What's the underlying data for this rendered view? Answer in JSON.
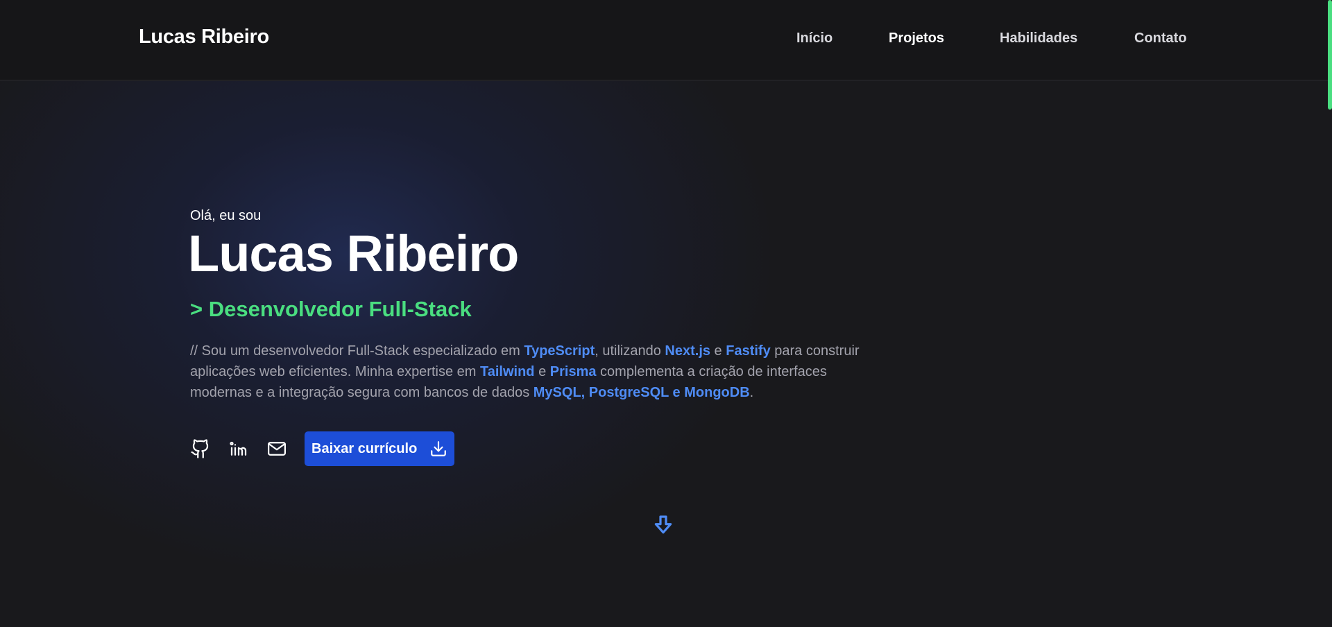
{
  "header": {
    "brand": "Lucas Ribeiro",
    "nav": [
      {
        "label": "Início"
      },
      {
        "label": "Projetos"
      },
      {
        "label": "Habilidades"
      },
      {
        "label": "Contato"
      }
    ]
  },
  "hero": {
    "greeting": "Olá, eu sou",
    "name": "Lucas Ribeiro",
    "role": "> Desenvolvedor Full-Stack",
    "bio": {
      "p1": "// Sou um desenvolvedor Full-Stack especializado em ",
      "t1": "TypeScript",
      "p2": ", utilizando ",
      "t2": "Next.js",
      "p3": " e ",
      "t3": "Fastify",
      "p4": " para construir aplicações web eficientes. Minha expertise em ",
      "t4": "Tailwind",
      "p5": " e ",
      "t5": "Prisma",
      "p6": " complementa a criação de interfaces modernas e a integração segura com bancos de dados ",
      "t6": "MySQL, PostgreSQL e MongoDB",
      "p7": "."
    },
    "socials": [
      {
        "icon": "github-icon"
      },
      {
        "icon": "linkedin-icon"
      },
      {
        "icon": "mail-icon"
      }
    ],
    "cv_button": {
      "label": "Baixar currículo",
      "icon": "download-icon"
    },
    "scroll_down_icon": "arrow-down-icon"
  },
  "colors": {
    "background": "#19191c",
    "header_bg": "#161618",
    "accent_green": "#4ade80",
    "accent_blue": "#4f8cf5",
    "button_blue": "#1d4ed8",
    "text_muted": "#a3a3ad"
  }
}
